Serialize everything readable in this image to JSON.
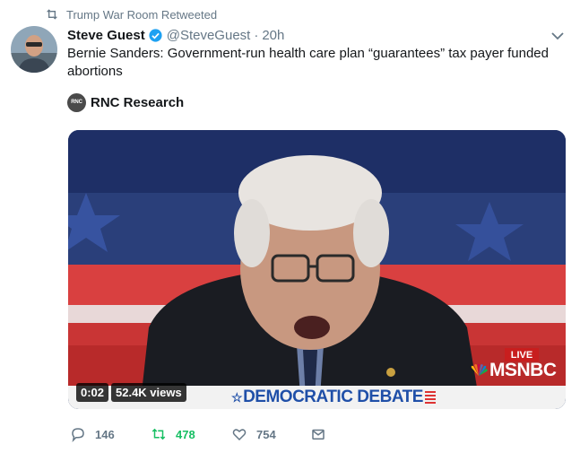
{
  "retweet_context": {
    "icon": "retweet-icon",
    "text": "Trump War Room Retweeted"
  },
  "author": {
    "avatar_icon": "avatar",
    "name": "Steve Guest",
    "verified_icon": "verified-badge-icon",
    "handle": "@SteveGuest",
    "separator": "·",
    "time": "20h"
  },
  "menu_icon": "chevron-down-icon",
  "tweet": {
    "text": "Bernie Sanders: Government-run health care plan “guarantees” tax payer funded abortions"
  },
  "quoted_source": {
    "logo_text": "RNC",
    "name": "RNC Research"
  },
  "video": {
    "live_label": "LIVE",
    "network": "MSNBC",
    "lower_third": "DEMOCRATIC DEBATE",
    "elapsed": "0:02",
    "views": "52.4K views"
  },
  "actions": {
    "replies": {
      "icon": "reply-icon",
      "count": "146"
    },
    "retweets": {
      "icon": "retweet-icon",
      "count": "478",
      "color": "#17bf63"
    },
    "likes": {
      "icon": "heart-icon",
      "count": "754"
    },
    "message": {
      "icon": "envelope-icon"
    }
  },
  "colors": {
    "secondary_text": "#657786",
    "primary_text": "#14171a",
    "verified_blue": "#1da1f2",
    "retweet_green": "#17bf63"
  }
}
